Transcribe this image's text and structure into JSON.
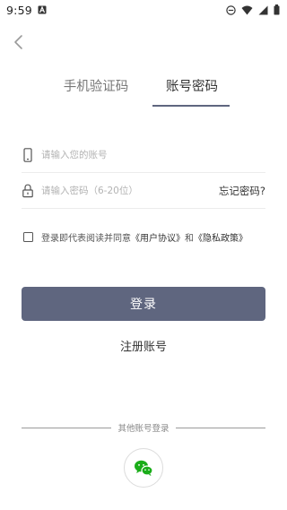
{
  "status_bar": {
    "time": "9:59"
  },
  "tabs": [
    {
      "label": "手机验证码",
      "active": false
    },
    {
      "label": "账号密码",
      "active": true
    }
  ],
  "account_field": {
    "placeholder": "请输入您的账号",
    "value": ""
  },
  "password_field": {
    "placeholder": "请输入密码（6-20位）",
    "value": ""
  },
  "forgot_password": "忘记密码?",
  "agreement": {
    "checked": false,
    "prefix": "登录即代表阅读并同意",
    "user_agreement": "《用户协议》",
    "conjunction": "和",
    "privacy_policy": "《隐私政策》"
  },
  "login_button": "登录",
  "register_link": "注册账号",
  "other_login": {
    "label": "其他账号登录"
  },
  "colors": {
    "primary": "#5f667f",
    "wechat": "#1aad19"
  }
}
